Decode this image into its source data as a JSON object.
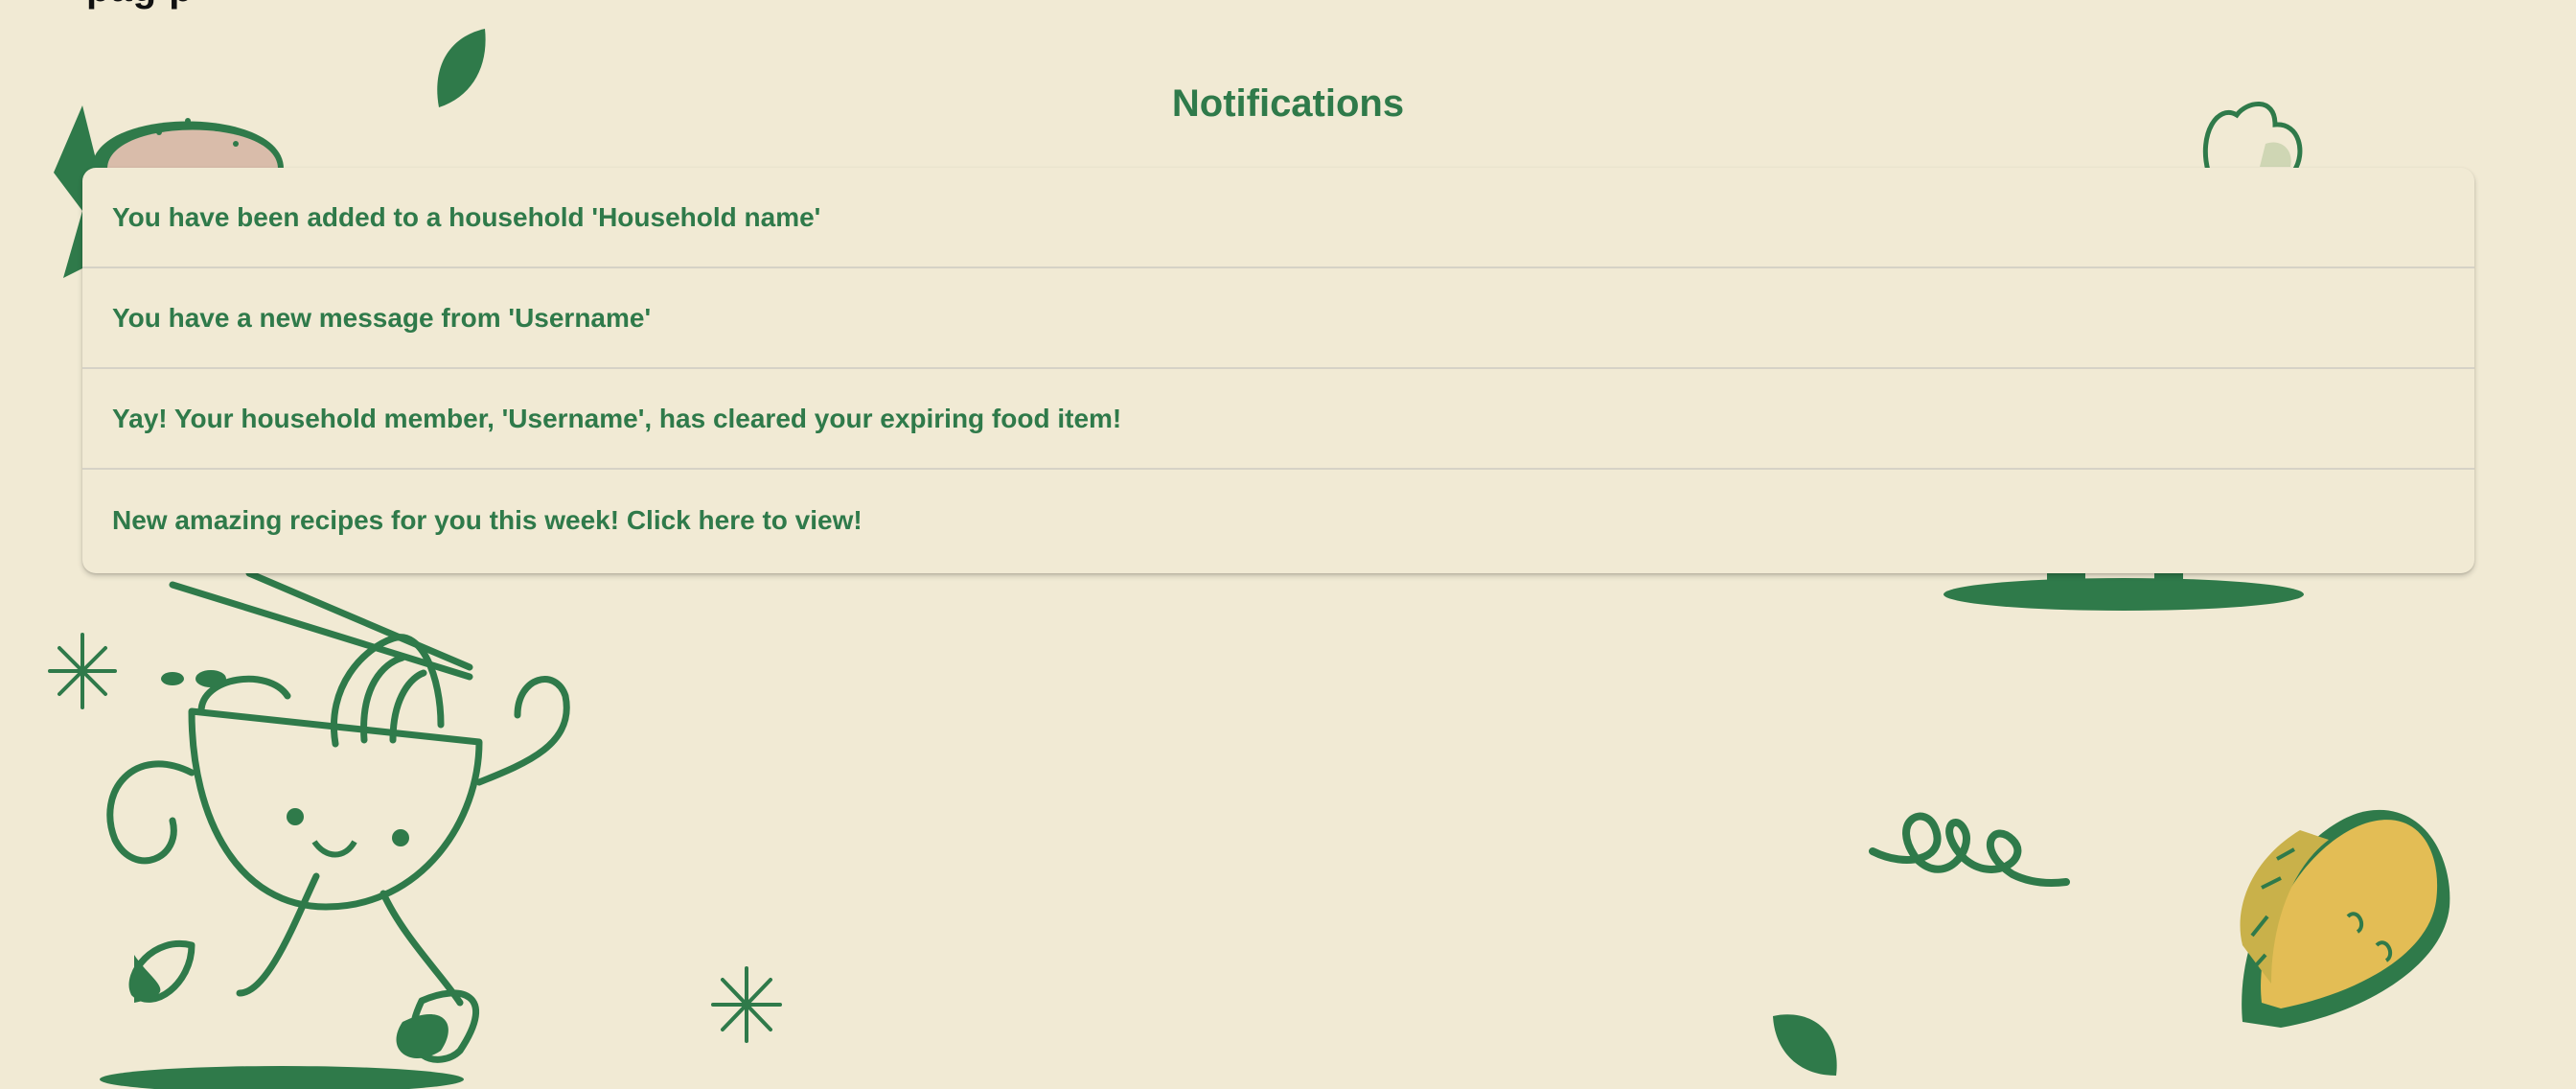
{
  "header_cut_text": "pag        p",
  "page_title": "Notifications",
  "notifications": [
    {
      "text": "You have been added to a household 'Household name'"
    },
    {
      "text": "You have a new message from 'Username'"
    },
    {
      "text": "Yay! Your household member, 'Username', has cleared your expiring food item!"
    },
    {
      "text": "New amazing recipes for you this week! Click here to view!"
    }
  ],
  "colors": {
    "background": "#f1ead4",
    "accent_green": "#2f7a4a",
    "taco_yellow": "#e3bd55"
  },
  "icons": [
    "burger-illustration",
    "leaf-icon",
    "heart-doodle-icon",
    "noodle-bowl-mascot",
    "sparkle-icon",
    "squiggle-icon",
    "taco-illustration"
  ]
}
